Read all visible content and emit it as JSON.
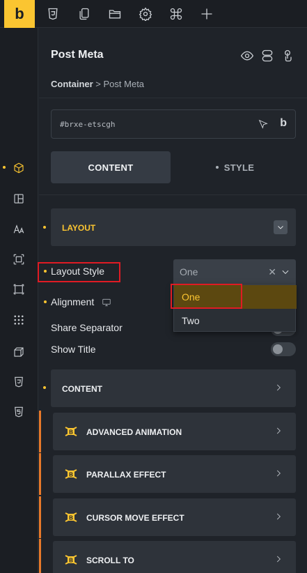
{
  "app": {
    "logo_text": "b",
    "brand_color": "#fbc531",
    "accent_orange": "#e8792a"
  },
  "toolbar": {
    "icons": [
      "css3-icon",
      "pages-icon",
      "folder-icon",
      "settings-gear-icon",
      "command-icon",
      "plus-icon"
    ]
  },
  "sidebar": {
    "icons": [
      "cube-icon",
      "layout-icon",
      "typography-icon",
      "spacing-icon",
      "box-icon",
      "grid-dots-icon",
      "3d-box-icon",
      "css3-icon",
      "html5-icon"
    ],
    "active": "cube-icon"
  },
  "panel": {
    "title": "Post Meta",
    "breadcrumb": {
      "parent": "Container",
      "separator": ">",
      "current": "Post Meta"
    },
    "element_id": "#brxe-etscgh",
    "id_field_badge": "b",
    "tabs": {
      "content": "CONTENT",
      "style": "STYLE"
    }
  },
  "layout_section": {
    "label": "LAYOUT",
    "layout_style": {
      "label": "Layout Style",
      "value": "One",
      "clear_glyph": "✕",
      "options": [
        "One",
        "Two"
      ],
      "selected_option": "One"
    },
    "alignment_label": "Alignment",
    "share_separator_label": "Share Separator",
    "show_title_label": "Show Title",
    "share_separator_on": false,
    "show_title_on": false
  },
  "sections": {
    "content": "CONTENT",
    "advanced_animation": "ADVANCED ANIMATION",
    "parallax_effect": "PARALLAX EFFECT",
    "cursor_move_effect": "CURSOR MOVE EFFECT",
    "scroll_to": "SCROLL TO"
  }
}
